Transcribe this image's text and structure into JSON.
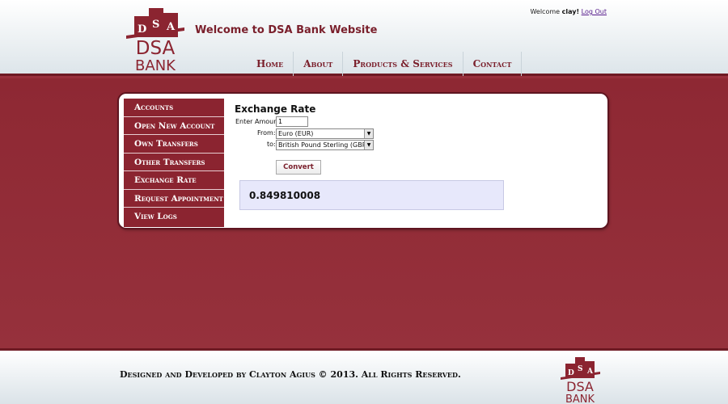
{
  "header": {
    "logo": {
      "letters": [
        "D",
        "S",
        "A"
      ],
      "line1": "DSA",
      "line2": "BANK"
    },
    "welcome_title": "Welcome to DSA Bank Website",
    "user_greeting": "Welcome",
    "username": "clay!",
    "logout_label": "Log Out",
    "nav": [
      {
        "label": "Home"
      },
      {
        "label": "About"
      },
      {
        "label": "Products & Services"
      },
      {
        "label": "Contact"
      }
    ]
  },
  "sidebar": {
    "items": [
      {
        "label": "Accounts"
      },
      {
        "label": "Open New Account"
      },
      {
        "label": "Own Transfers"
      },
      {
        "label": "Other Transfers"
      },
      {
        "label": "Exchange Rate"
      },
      {
        "label": "Request Appointment"
      },
      {
        "label": "View Logs"
      }
    ]
  },
  "exchange": {
    "title": "Exchange Rate",
    "amount_label": "Enter Amount",
    "amount_value": "1",
    "from_label": "From:",
    "from_value": "Euro (EUR)",
    "to_label": "to:",
    "to_value": "British Pound Sterling (GBP)",
    "convert_label": "Convert",
    "result": "0.849810008"
  },
  "footer": {
    "text": "Designed and Developed by Clayton Agius © 2013. All Rights Reserved."
  },
  "colors": {
    "brand": "#8b2430",
    "band": "#98303c",
    "result_bg": "#e7e8fb"
  }
}
